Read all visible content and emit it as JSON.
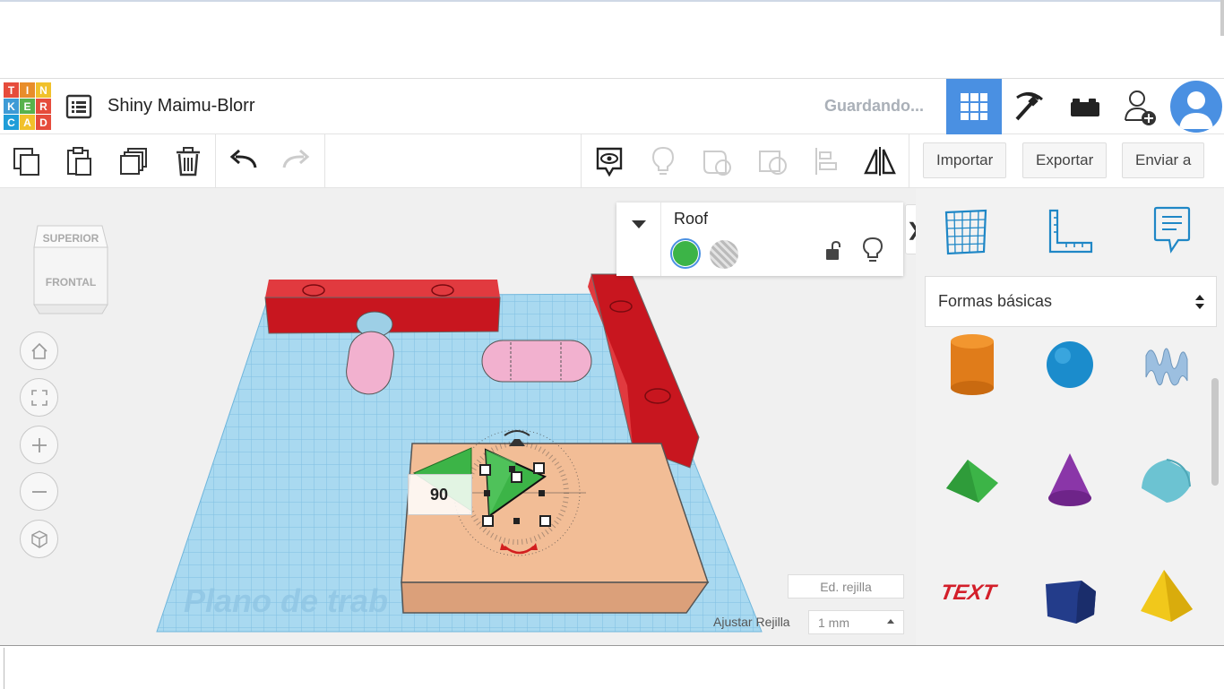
{
  "app": {
    "logo_letters": [
      "T",
      "I",
      "N",
      "K",
      "E",
      "R",
      "C",
      "A",
      "D"
    ],
    "logo_colors": [
      "#e64c3c",
      "#e88d2a",
      "#f1c12b",
      "#3e9bd6",
      "#58b24c",
      "#e64c3c",
      "#1f9dd8",
      "#f1c12b",
      "#e64c3c"
    ],
    "project_title": "Shiny Maimu-Blorr",
    "save_status": "Guardando..."
  },
  "header": {
    "buttons": [
      {
        "name": "3d-design-view",
        "icon": "grid-icon",
        "active": true
      },
      {
        "name": "minecraft-view",
        "icon": "pickaxe-icon",
        "active": false
      },
      {
        "name": "bricks-view",
        "icon": "bricks-icon",
        "active": false
      },
      {
        "name": "add-user",
        "icon": "add-user-icon",
        "active": false
      },
      {
        "name": "profile",
        "icon": "avatar-icon",
        "active": false
      }
    ]
  },
  "toolbar": {
    "tools": [
      {
        "name": "copy",
        "icon": "copy-icon",
        "enabled": true
      },
      {
        "name": "paste",
        "icon": "paste-icon",
        "enabled": true
      },
      {
        "name": "duplicate",
        "icon": "duplicate-icon",
        "enabled": true
      },
      {
        "name": "delete",
        "icon": "trash-icon",
        "enabled": true
      },
      {
        "name": "undo",
        "icon": "undo-icon",
        "enabled": true
      },
      {
        "name": "redo",
        "icon": "redo-icon",
        "enabled": false
      }
    ],
    "view_tools": [
      {
        "name": "notes",
        "icon": "note-eye-icon",
        "enabled": true
      },
      {
        "name": "show-all",
        "icon": "bulb-icon",
        "enabled": false
      },
      {
        "name": "group",
        "icon": "group-icon",
        "enabled": false
      },
      {
        "name": "ungroup",
        "icon": "ungroup-icon",
        "enabled": false
      },
      {
        "name": "align",
        "icon": "align-icon",
        "enabled": false
      },
      {
        "name": "mirror",
        "icon": "mirror-icon",
        "enabled": true
      }
    ],
    "import_label": "Importar",
    "export_label": "Exportar",
    "send_label": "Enviar a"
  },
  "viewcube": {
    "top_label": "SUPERIOR",
    "front_label": "FRONTAL"
  },
  "nav_buttons": [
    "home-icon",
    "fit-icon",
    "zoom-in-icon",
    "zoom-out-icon",
    "perspective-icon"
  ],
  "properties": {
    "shape_name": "Roof",
    "solid_color": "#3cb447",
    "mode": "solid"
  },
  "workplane": {
    "watermark": "Plano de trab",
    "rotation_value": "90",
    "grid_edit_label": "Ed. rejilla",
    "snap_label": "Ajustar Rejilla",
    "snap_value": "1 mm"
  },
  "colors": {
    "accent": "#4a90e2",
    "grid_blue": "#a7d7ef",
    "red_box": "#d9202c",
    "pink_capsule": "#f0a9c8",
    "base_box": "#f2bd96",
    "roof_green": "#3cb447"
  },
  "sidebar": {
    "tabs": [
      {
        "name": "workplane-tab",
        "icon": "workplane-grid-icon"
      },
      {
        "name": "ruler-tab",
        "icon": "ruler-icon"
      },
      {
        "name": "notes-tab",
        "icon": "note-icon"
      }
    ],
    "library": "Formas básicas",
    "shapes": [
      {
        "name": "cylinder",
        "icon": "cylinder-icon",
        "color": "#e07c1a"
      },
      {
        "name": "sphere",
        "icon": "sphere-icon",
        "color": "#1b8ccc"
      },
      {
        "name": "scribble",
        "icon": "scribble-icon",
        "color": "#9cbfe0"
      },
      {
        "name": "roof",
        "icon": "roof-icon",
        "color": "#3cb447"
      },
      {
        "name": "cone",
        "icon": "cone-icon",
        "color": "#8a36a8"
      },
      {
        "name": "round-roof",
        "icon": "round-roof-icon",
        "color": "#6cc3d2"
      },
      {
        "name": "text",
        "icon": "text-icon",
        "color": "#d31f2a",
        "label": "TEXT"
      },
      {
        "name": "polygon",
        "icon": "polygon-icon",
        "color": "#233c8a"
      },
      {
        "name": "pyramid",
        "icon": "pyramid-icon",
        "color": "#f1c81b"
      }
    ]
  }
}
